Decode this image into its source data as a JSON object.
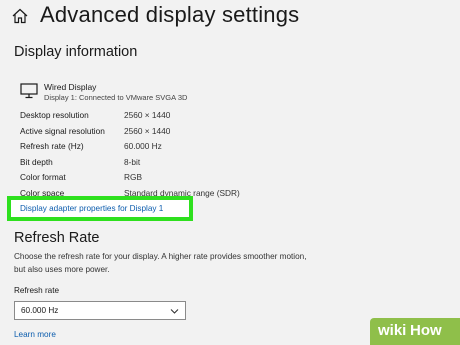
{
  "header": {
    "title": "Advanced display settings",
    "home_icon": "home-icon"
  },
  "display_info": {
    "section_title": "Display information",
    "display_name": "Wired Display",
    "display_sub": "Display 1: Connected to VMware SVGA 3D",
    "rows": [
      {
        "key": "Desktop resolution",
        "value": "2560 × 1440"
      },
      {
        "key": "Active signal resolution",
        "value": "2560 × 1440"
      },
      {
        "key": "Refresh rate (Hz)",
        "value": "60.000 Hz"
      },
      {
        "key": "Bit depth",
        "value": "8-bit"
      },
      {
        "key": "Color format",
        "value": "RGB"
      },
      {
        "key": "Color space",
        "value": "Standard dynamic range (SDR)"
      }
    ],
    "adapter_link": "Display adapter properties for Display 1",
    "highlight_color": "#2ee01e"
  },
  "refresh_rate": {
    "title": "Refresh Rate",
    "description": "Choose the refresh rate for your display. A higher rate provides smoother motion, but also uses more power.",
    "label": "Refresh rate",
    "selected": "60.000 Hz",
    "learn_more": "Learn more"
  },
  "watermark": {
    "part1": "wiki",
    "part2": "How",
    "color": "#8fbf4a"
  }
}
